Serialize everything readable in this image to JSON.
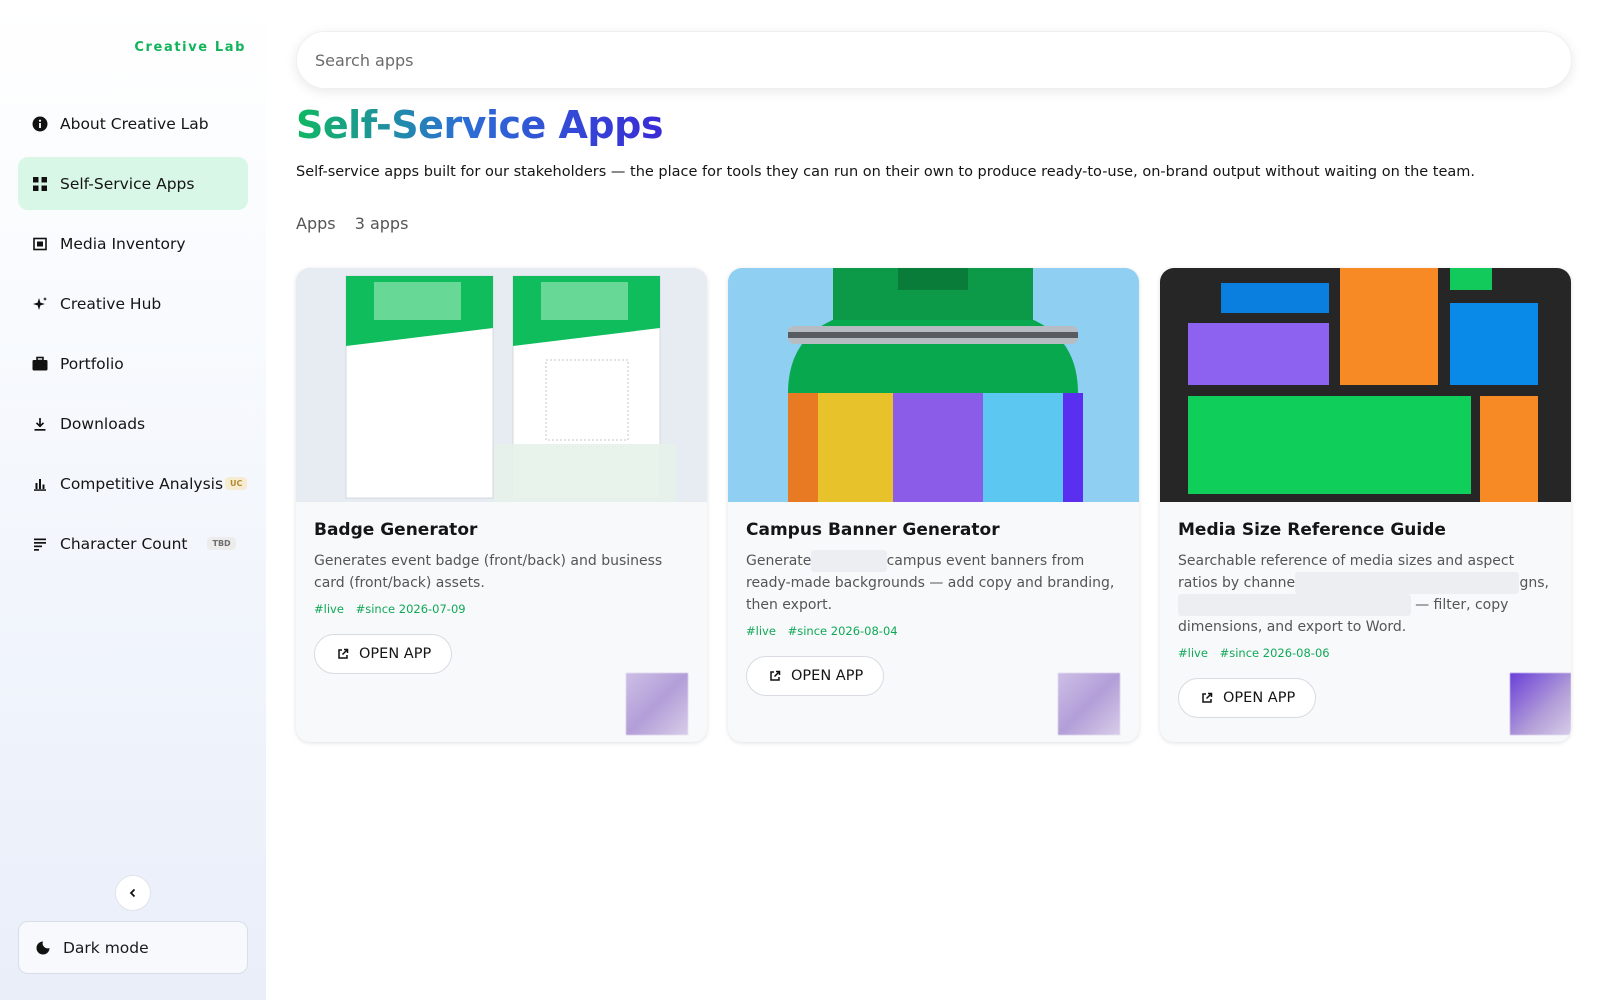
{
  "brand": "Creative Lab",
  "sidebar": {
    "items": [
      {
        "label": "About Creative Lab",
        "icon": "info-icon"
      },
      {
        "label": "Self-Service Apps",
        "icon": "grid-icon",
        "active": true
      },
      {
        "label": "Media Inventory",
        "icon": "media-icon"
      },
      {
        "label": "Creative Hub",
        "icon": "sparkle-icon"
      },
      {
        "label": "Portfolio",
        "icon": "briefcase-icon"
      },
      {
        "label": "Downloads",
        "icon": "download-icon"
      },
      {
        "label": "Competitive Analysis",
        "icon": "bar-chart-icon",
        "badge": "UC"
      },
      {
        "label": "Character Count",
        "icon": "text-lines-icon",
        "badge": "TBD"
      }
    ],
    "dark_mode_label": "Dark mode"
  },
  "search": {
    "placeholder": "Search apps"
  },
  "page": {
    "title": "Self-Service Apps",
    "subtitle": "Self-service apps built for our stakeholders — the place for tools they can run on their own to produce ready-to-use, on-brand output without waiting on the team.",
    "apps_label": "Apps",
    "apps_count": "3 apps"
  },
  "cards": [
    {
      "title": "Badge Generator",
      "description": "Generates event badge (front/back) and business card (front/back) assets.",
      "tags": [
        "live",
        "since 2026-07-09"
      ],
      "button": "OPEN APP"
    },
    {
      "title": "Campus Banner Generator",
      "description_parts": [
        "Generate",
        "campus event banners from ready-made backgrounds — add copy and branding, then export."
      ],
      "tags": [
        "live",
        "since 2026-08-04"
      ],
      "button": "OPEN APP"
    },
    {
      "title": "Media Size Reference Guide",
      "description_parts": [
        "Searchable reference of media sizes and aspect ratios by channe",
        "gns,",
        "— filter, copy dimensions, and export to Word."
      ],
      "tags": [
        "live",
        "since 2026-08-06"
      ],
      "button": "OPEN APP"
    }
  ],
  "colors": {
    "brand_green": "#12b35a",
    "active_bg": "#d9f7e6",
    "title_gradient_start": "#10b861",
    "title_gradient_end": "#3a2ad6",
    "tag_green": "#10a857"
  }
}
